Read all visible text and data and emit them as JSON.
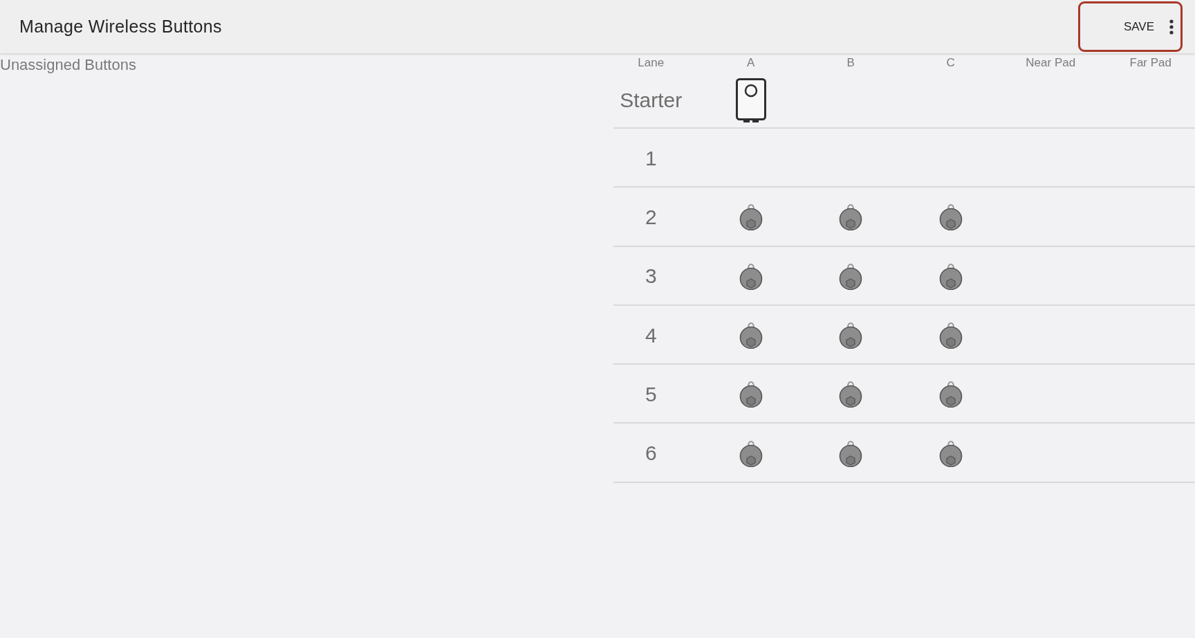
{
  "app_bar": {
    "title": "Manage Wireless Buttons",
    "actions": {
      "highlighted": true,
      "save": "SAVE"
    }
  },
  "unassigned": {
    "title": "Unassigned Buttons"
  },
  "lanes": {
    "columns": [
      "Lane",
      "A",
      "B",
      "C",
      "Near Pad",
      "Far Pad"
    ],
    "rows": [
      {
        "lane": "Starter",
        "cells": [
          {
            "kind": "starter"
          },
          {
            "kind": "empty"
          },
          {
            "kind": "empty"
          },
          {
            "kind": "empty"
          },
          {
            "kind": "empty"
          }
        ]
      },
      {
        "lane": "1",
        "cells": [
          {
            "kind": "empty"
          },
          {
            "kind": "empty"
          },
          {
            "kind": "empty"
          },
          {
            "kind": "empty"
          },
          {
            "kind": "empty"
          }
        ]
      },
      {
        "lane": "2",
        "cells": [
          {
            "kind": "button"
          },
          {
            "kind": "button"
          },
          {
            "kind": "button"
          },
          {
            "kind": "empty"
          },
          {
            "kind": "empty"
          }
        ]
      },
      {
        "lane": "3",
        "cells": [
          {
            "kind": "button"
          },
          {
            "kind": "button"
          },
          {
            "kind": "button"
          },
          {
            "kind": "empty"
          },
          {
            "kind": "empty"
          }
        ]
      },
      {
        "lane": "4",
        "cells": [
          {
            "kind": "button"
          },
          {
            "kind": "button"
          },
          {
            "kind": "button"
          },
          {
            "kind": "empty"
          },
          {
            "kind": "empty"
          }
        ]
      },
      {
        "lane": "5",
        "cells": [
          {
            "kind": "button"
          },
          {
            "kind": "button"
          },
          {
            "kind": "button"
          },
          {
            "kind": "empty"
          },
          {
            "kind": "empty"
          }
        ]
      },
      {
        "lane": "6",
        "cells": [
          {
            "kind": "button"
          },
          {
            "kind": "button"
          },
          {
            "kind": "button"
          },
          {
            "kind": "empty"
          },
          {
            "kind": "empty"
          }
        ]
      }
    ]
  }
}
